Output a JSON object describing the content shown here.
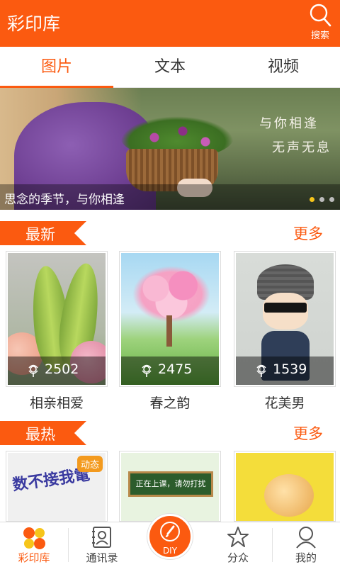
{
  "header": {
    "title": "彩印库",
    "search_label": "搜索"
  },
  "tabs": [
    {
      "label": "图片",
      "active": true
    },
    {
      "label": "文本",
      "active": false
    },
    {
      "label": "视频",
      "active": false
    }
  ],
  "banner": {
    "caption": "思念的季节，与你相逢",
    "overlay_line1": "与你相逢",
    "overlay_line2": "无声无息",
    "dots": 3,
    "active_dot": 1
  },
  "sections": {
    "latest": {
      "title": "最新",
      "more": "更多",
      "items": [
        {
          "title": "相亲相爱",
          "count": "2502"
        },
        {
          "title": "春之韵",
          "count": "2475"
        },
        {
          "title": "花美男",
          "count": "1539"
        }
      ]
    },
    "hottest": {
      "title": "最热",
      "more": "更多",
      "items": [
        {
          "badge": "动态",
          "art_text": "数不接我電"
        },
        {
          "blackboard_text": "正在上课，请勿打扰"
        },
        {}
      ]
    }
  },
  "bottom_nav": {
    "items": [
      {
        "label": "彩印库",
        "active": true,
        "icon": "app-logo-icon"
      },
      {
        "label": "通讯录",
        "active": false,
        "icon": "contacts-icon"
      },
      {
        "label": "DIY",
        "active": false,
        "icon": "brush-icon"
      },
      {
        "label": "分众",
        "active": false,
        "icon": "star-icon"
      },
      {
        "label": "我的",
        "active": false,
        "icon": "user-icon"
      }
    ]
  },
  "colors": {
    "accent": "#fb5a10",
    "dot_active": "#f6c51a"
  }
}
